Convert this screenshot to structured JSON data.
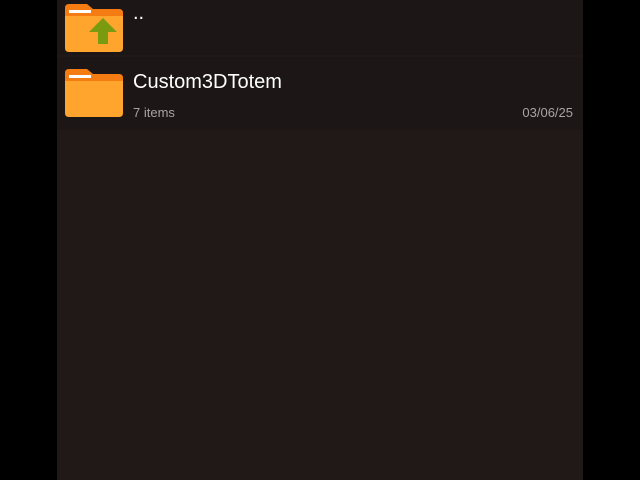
{
  "file_list": {
    "parent_entry": {
      "name": "..",
      "icon": "folder-up-icon"
    },
    "items": [
      {
        "name": "Custom3DTotem",
        "count": "7 items",
        "date": "03/06/25",
        "icon": "folder-icon"
      }
    ]
  },
  "colors": {
    "background": "#201918",
    "row_background": "#1c1716",
    "folder_body": "#ffa42c",
    "folder_tab": "#f57c12",
    "up_arrow": "#7a9a10",
    "primary_text": "#ffffff",
    "secondary_text": "#a9a3a1"
  }
}
